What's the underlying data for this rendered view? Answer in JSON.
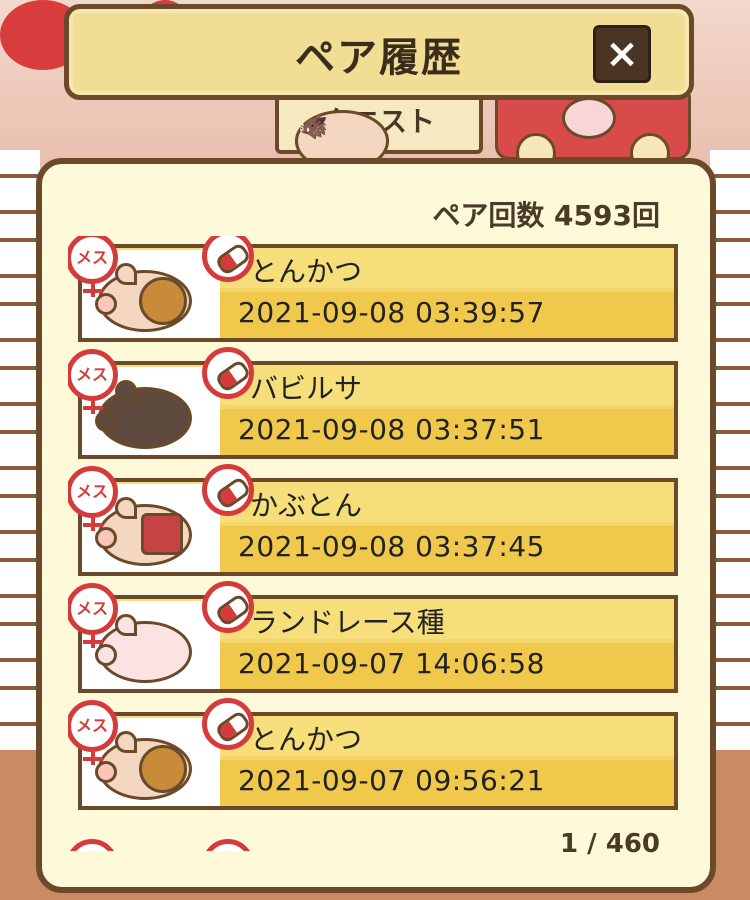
{
  "header": {
    "title": "ペア履歴",
    "close_label": "×"
  },
  "background": {
    "sign_text": "クエスト"
  },
  "panel": {
    "pair_count": "ペア回数 4593回",
    "pager": "1 / 460"
  },
  "icons": {
    "female_badge": "メス"
  },
  "history": [
    {
      "name": "とんかつ",
      "time": "2021-09-08 03:39:57",
      "pig": "fuzzy"
    },
    {
      "name": "バビルサ",
      "time": "2021-09-08 03:37:51",
      "pig": "dark"
    },
    {
      "name": "かぶとん",
      "time": "2021-09-08 03:37:45",
      "pig": "armored"
    },
    {
      "name": "ランドレース種",
      "time": "2021-09-07 14:06:58",
      "pig": "pink"
    },
    {
      "name": "とんかつ",
      "time": "2021-09-07 09:56:21",
      "pig": "fuzzy"
    }
  ],
  "colors": {
    "brown": "#6b4a2a",
    "panel_bg": "#fdf9d9",
    "row_gold": "#f0c94c",
    "red": "#d63b3b"
  }
}
